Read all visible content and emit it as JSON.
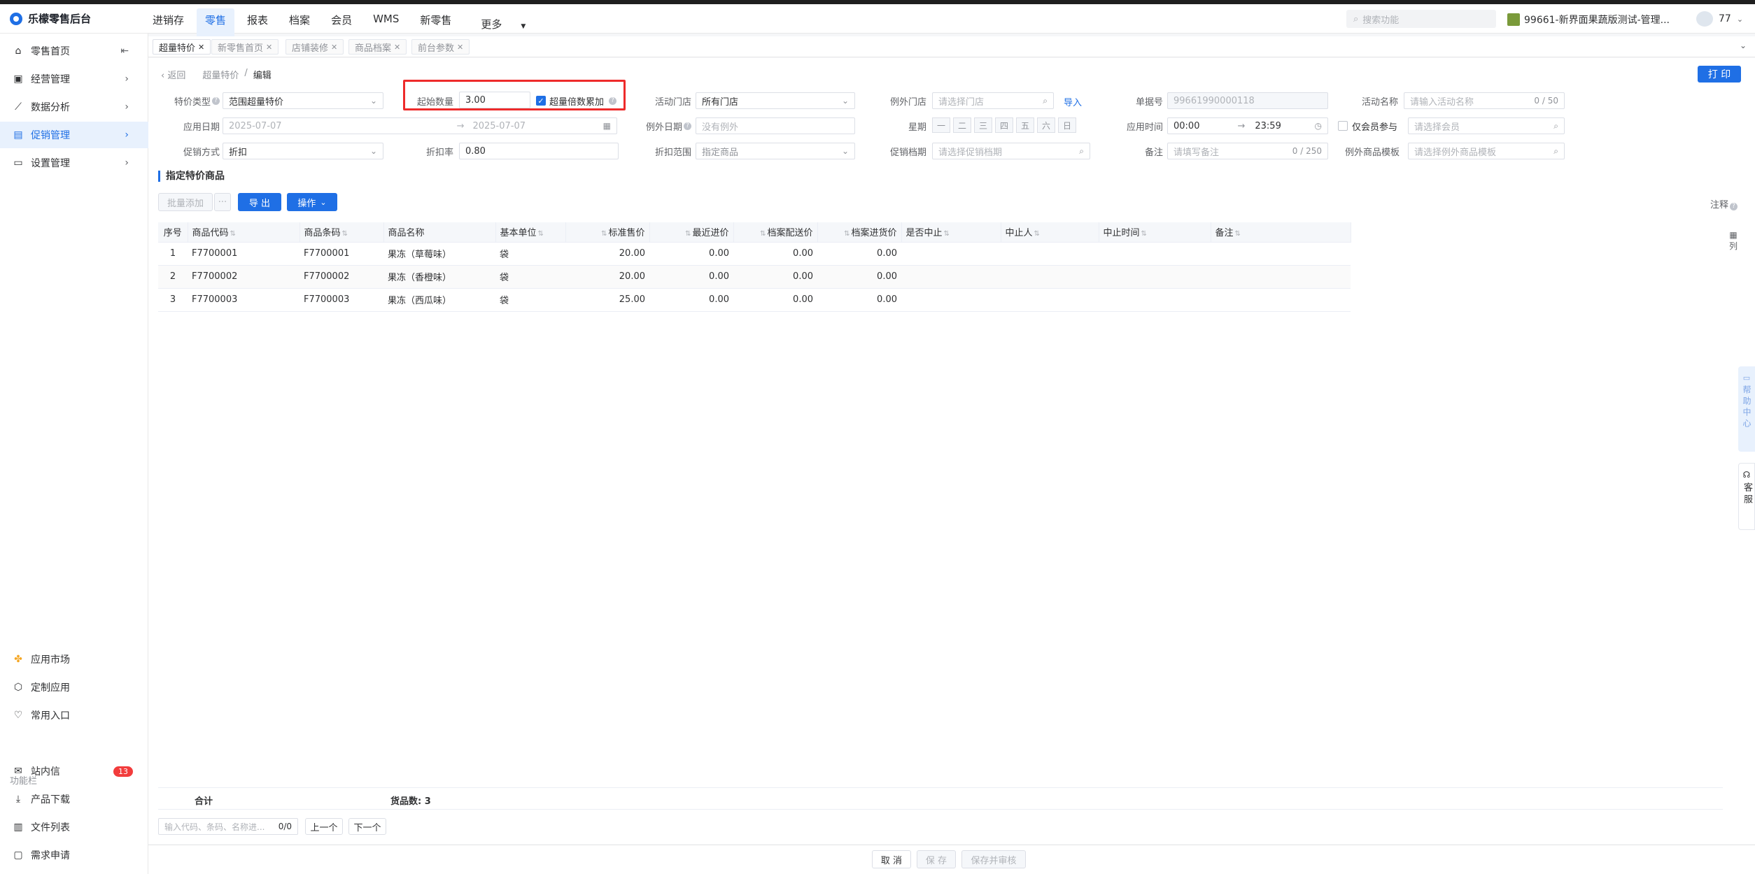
{
  "app": {
    "title": "乐檬零售后台"
  },
  "topnav": [
    "进销存",
    "零售",
    "报表",
    "档案",
    "会员",
    "WMS",
    "新零售",
    "更多"
  ],
  "topnav_active": 1,
  "search": {
    "placeholder": "搜索功能"
  },
  "store": {
    "name": "99661-新界面果蔬版测试-管理..."
  },
  "user": {
    "name": "77"
  },
  "sidebar": {
    "items": [
      {
        "label": "零售首页",
        "icon": "home-icon"
      },
      {
        "label": "经营管理",
        "icon": "shop-icon"
      },
      {
        "label": "数据分析",
        "icon": "chart-icon"
      },
      {
        "label": "促销管理",
        "icon": "promotion-icon"
      },
      {
        "label": "设置管理",
        "icon": "folder-icon"
      }
    ],
    "bottom_items": [
      {
        "label": "应用市场"
      },
      {
        "label": "定制应用"
      },
      {
        "label": "常用入口"
      }
    ],
    "group_label": "功能栏",
    "tool_items": [
      {
        "label": "站内信",
        "badge": "13"
      },
      {
        "label": "产品下载"
      },
      {
        "label": "文件列表"
      },
      {
        "label": "需求申请"
      }
    ]
  },
  "tabs": [
    "超量特价",
    "新零售首页",
    "店铺装修",
    "商品档案",
    "前台参数"
  ],
  "breadcrumb": {
    "back": "返回",
    "parent": "超量特价",
    "current": "编辑"
  },
  "print_label": "打 印",
  "form": {
    "special_type": {
      "label": "特价类型",
      "value": "范围超量特价"
    },
    "start_qty": {
      "label": "起始数量",
      "value": "3.00"
    },
    "multiple": {
      "label": "超量倍数累加",
      "checked": true
    },
    "active_store": {
      "label": "活动门店",
      "value": "所有门店"
    },
    "except_store": {
      "label": "例外门店",
      "placeholder": "请选择门店",
      "import": "导入"
    },
    "doc_no": {
      "label": "单据号",
      "value": "99661990000118"
    },
    "activity_name": {
      "label": "活动名称",
      "placeholder": "请输入活动名称",
      "count": "0 / 50"
    },
    "apply_date": {
      "label": "应用日期",
      "start": "2025-07-07",
      "end": "2025-07-07"
    },
    "except_date": {
      "label": "例外日期",
      "placeholder": "没有例外"
    },
    "weekday": {
      "label": "星期",
      "days": [
        "一",
        "二",
        "三",
        "四",
        "五",
        "六",
        "日"
      ]
    },
    "apply_time": {
      "label": "应用时间",
      "start": "00:00",
      "end": "23:59"
    },
    "member_only": {
      "label": "仅会员参与",
      "checked": false,
      "placeholder": "请选择会员"
    },
    "promo_method": {
      "label": "促销方式",
      "value": "折扣"
    },
    "discount_rate": {
      "label": "折扣率",
      "value": "0.80"
    },
    "discount_scope": {
      "label": "折扣范围",
      "value": "指定商品"
    },
    "promo_period": {
      "label": "促销档期",
      "placeholder": "请选择促销档期"
    },
    "remark": {
      "label": "备注",
      "placeholder": "请填写备注",
      "count": "0 / 250"
    },
    "except_template": {
      "label": "例外商品模板",
      "placeholder": "请选择例外商品模板"
    }
  },
  "section_title": "指定特价商品",
  "toolbar": {
    "batch_add": "批量添加",
    "more": "···",
    "export": "导 出",
    "operate": "操作"
  },
  "note_label": "注释",
  "col_settings": "列",
  "table": {
    "headers": [
      "序号",
      "商品代码",
      "商品条码",
      "商品名称",
      "基本单位",
      "标准售价",
      "最近进价",
      "档案配送价",
      "档案进货价",
      "是否中止",
      "中止人",
      "中止时间",
      "备注"
    ],
    "rows": [
      [
        "1",
        "F7700001",
        "F7700001",
        "果冻（草莓味）",
        "袋",
        "20.00",
        "0.00",
        "0.00",
        "0.00",
        "",
        "",
        "",
        ""
      ],
      [
        "2",
        "F7700002",
        "F7700002",
        "果冻（香橙味）",
        "袋",
        "20.00",
        "0.00",
        "0.00",
        "0.00",
        "",
        "",
        "",
        ""
      ],
      [
        "3",
        "F7700003",
        "F7700003",
        "果冻（西瓜味）",
        "袋",
        "25.00",
        "0.00",
        "0.00",
        "0.00",
        "",
        "",
        "",
        ""
      ]
    ],
    "footer": {
      "total": "合计",
      "count": "货品数: 3"
    }
  },
  "finder": {
    "placeholder": "输入代码、条码、名称进...",
    "count": "0/0",
    "prev": "上一个",
    "next": "下一个"
  },
  "actions": {
    "cancel": "取 消",
    "save": "保 存",
    "save_audit": "保存并审核"
  },
  "side_help": "帮助中心",
  "side_service": "客服"
}
